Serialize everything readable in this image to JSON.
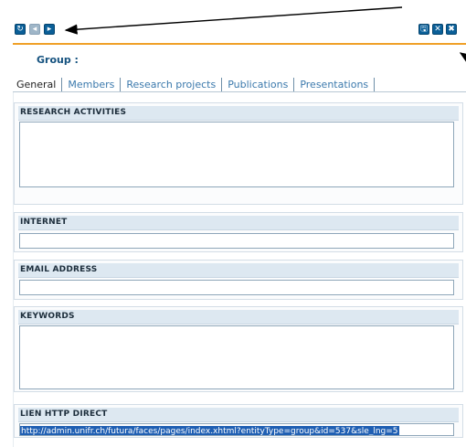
{
  "toolbar": {
    "left_buttons": [
      {
        "name": "refresh-button",
        "glyph": "↻"
      },
      {
        "name": "previous-button",
        "glyph": "◂"
      },
      {
        "name": "next-button",
        "glyph": "▸"
      }
    ],
    "right_buttons": [
      {
        "name": "save-button",
        "glyph": "🖫"
      },
      {
        "name": "tools-button",
        "glyph": "✕"
      },
      {
        "name": "close-button",
        "glyph": "✖"
      }
    ],
    "accent_color": "#f0a028",
    "button_color": "#0a5f98"
  },
  "group": {
    "label": "Group :"
  },
  "tabs": [
    {
      "label": "General",
      "active": true
    },
    {
      "label": "Members",
      "active": false
    },
    {
      "label": "Research projects",
      "active": false
    },
    {
      "label": "Publications",
      "active": false
    },
    {
      "label": "Presentations",
      "active": false
    }
  ],
  "sections": {
    "research_activities": {
      "title": "RESEARCH ACTIVITIES",
      "value": ""
    },
    "internet": {
      "title": "INTERNET",
      "value": ""
    },
    "email": {
      "title": "EMAIL ADDRESS",
      "value": ""
    },
    "keywords": {
      "title": "KEYWORDS",
      "value": ""
    },
    "direct_link": {
      "title": "LIEN HTTP DIRECT",
      "value": "http://admin.unifr.ch/futura/faces/pages/index.xhtml?entityType=group&id=537&sle_lng=5"
    }
  }
}
